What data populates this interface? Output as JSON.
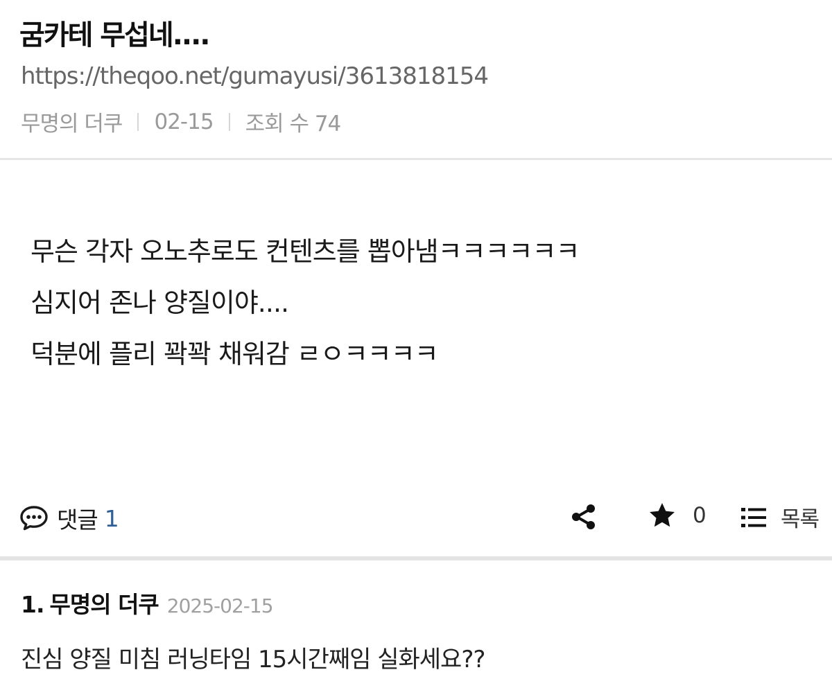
{
  "post": {
    "title": "굼카테 무섭네....",
    "url": "https://theqoo.net/gumayusi/3613818154",
    "author": "무명의 더쿠",
    "date": "02-15",
    "views_label": "조회 수 74"
  },
  "body": {
    "lines": [
      "무슨 각자 오노추로도 컨텐츠를 뽑아냄ㅋㅋㅋㅋㅋㅋ",
      "심지어 존나 양질이야....",
      "덕분에 플리 꽉꽉 채워감 ㄹㅇㅋㅋㅋㅋ"
    ]
  },
  "actions": {
    "comment_label": "댓글",
    "comment_count": "1",
    "star_count": "0",
    "list_label": "목록"
  },
  "comments": [
    {
      "number": "1.",
      "author": "무명의 더쿠",
      "date": "2025-02-15",
      "text": "진심 양질 미침 러닝타임 15시간째임 실화세요??"
    }
  ],
  "icons": {
    "comment": "speech-bubble-icon",
    "share": "share-icon",
    "star": "star-icon",
    "list": "list-icon"
  },
  "colors": {
    "comment_count": "#2f5f96",
    "meta_text": "#9a9a9a",
    "divider": "#e4e4e4"
  }
}
